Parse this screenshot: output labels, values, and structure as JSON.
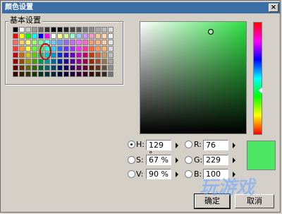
{
  "title": "颜色设置",
  "basic_colors_label": "基本设置",
  "basic_colors": [
    [
      "#000000",
      "#ffffff",
      "#cccccc",
      "#999999",
      "#666666",
      "#333333",
      "#000000",
      "#111111",
      "#222222",
      "#444444",
      "#555555",
      "#777777",
      "#888888",
      "#aaaaaa",
      "#bbbbbb",
      "#dddddd"
    ],
    [
      "#ff0000",
      "#ffff00",
      "#00ff00",
      "#00ffff",
      "#0000ff",
      "#ff00ff",
      "#ffffff",
      "#ffff99",
      "#ccff99",
      "#99ffcc",
      "#99ccff",
      "#cc99ff",
      "#ff99cc",
      "#ffcc99",
      "#ffd9b3",
      "#f2f2f2"
    ],
    [
      "#ff6666",
      "#ffcc66",
      "#ffff66",
      "#99ff66",
      "#66ff99",
      "#66ffff",
      "#66ccff",
      "#6699ff",
      "#9966ff",
      "#cc66ff",
      "#ff66ff",
      "#ff66cc",
      "#ff9966",
      "#ffb380",
      "#ffcc99",
      "#e6e6e6"
    ],
    [
      "#ff3333",
      "#ff9933",
      "#ffff33",
      "#66ff33",
      "#33ff66",
      "#33ffcc",
      "#33ccff",
      "#3366ff",
      "#6633ff",
      "#9933ff",
      "#ff33ff",
      "#ff3399",
      "#ff6633",
      "#ff9966",
      "#ffb366",
      "#d9d9d9"
    ],
    [
      "#cc0000",
      "#cc6600",
      "#cccc00",
      "#66cc00",
      "#00cc66",
      "#00cccc",
      "#0099cc",
      "#0033cc",
      "#3300cc",
      "#6600cc",
      "#cc00cc",
      "#cc0066",
      "#cc3300",
      "#cc6633",
      "#cc9966",
      "#bfbfbf"
    ],
    [
      "#990000",
      "#994c00",
      "#999900",
      "#4c9900",
      "#00994c",
      "#009999",
      "#006699",
      "#002699",
      "#260099",
      "#4c0099",
      "#990099",
      "#99004c",
      "#992600",
      "#994c26",
      "#99734c",
      "#a6a6a6"
    ],
    [
      "#660000",
      "#663300",
      "#666600",
      "#336600",
      "#006633",
      "#006666",
      "#004466",
      "#001a66",
      "#1a0066",
      "#330066",
      "#660066",
      "#660033",
      "#661a00",
      "#663319",
      "#664d33",
      "#8c8c8c"
    ],
    [
      "#330000",
      "#331a00",
      "#333300",
      "#1a3300",
      "#00331a",
      "#003333",
      "#002233",
      "#000d33",
      "#0d0033",
      "#1a0033",
      "#330033",
      "#33001a",
      "#330d00",
      "#331a0d",
      "#33261a",
      "#737373"
    ]
  ],
  "hsv": {
    "h_label": "H:",
    "h_value": "129 °",
    "s_label": "S:",
    "s_value": "67 %",
    "v_label": "V:",
    "v_value": "90 %"
  },
  "rgb": {
    "r_label": "R:",
    "r_value": "76",
    "g_label": "G:",
    "g_value": "229",
    "b_label": "B:",
    "b_value": "100"
  },
  "preview_color": "#4ce564",
  "spectrum_hue_color": "#2ee043",
  "buttons": {
    "ok": "确定",
    "cancel": "取消"
  },
  "watermark": "玩游戏"
}
